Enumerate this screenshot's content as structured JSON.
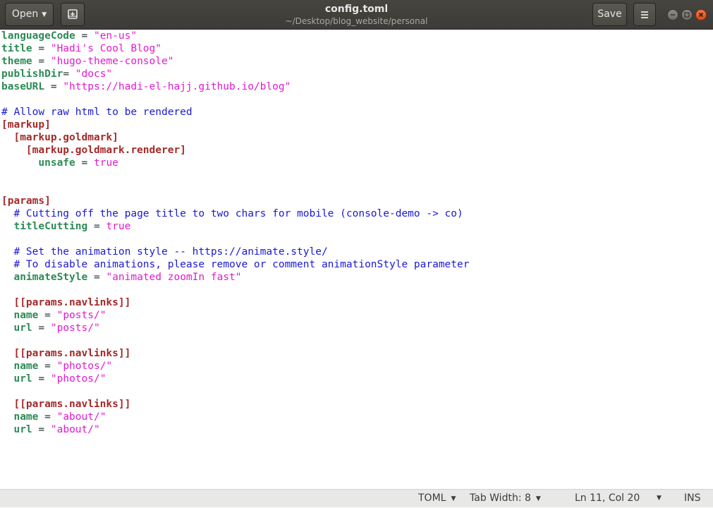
{
  "header": {
    "open_label": "Open",
    "title": "config.toml",
    "subtitle": "~/Desktop/blog_website/personal",
    "save_label": "Save"
  },
  "editor": {
    "lines": [
      [
        {
          "t": "key",
          "v": "languageCode"
        },
        {
          "t": "op",
          "v": " = "
        },
        {
          "t": "str",
          "v": "\"en-us\""
        }
      ],
      [
        {
          "t": "key",
          "v": "title"
        },
        {
          "t": "op",
          "v": " = "
        },
        {
          "t": "str",
          "v": "\"Hadi's Cool Blog\""
        }
      ],
      [
        {
          "t": "key",
          "v": "theme"
        },
        {
          "t": "op",
          "v": " = "
        },
        {
          "t": "str",
          "v": "\"hugo-theme-console\""
        }
      ],
      [
        {
          "t": "key",
          "v": "publishDir"
        },
        {
          "t": "op",
          "v": "= "
        },
        {
          "t": "str",
          "v": "\"docs\""
        }
      ],
      [
        {
          "t": "key",
          "v": "baseURL"
        },
        {
          "t": "op",
          "v": " = "
        },
        {
          "t": "str",
          "v": "\"https://hadi-el-hajj.github.io/blog\""
        }
      ],
      [],
      [
        {
          "t": "com",
          "v": "# Allow raw html to be rendered"
        }
      ],
      [
        {
          "t": "sec",
          "v": "[markup]"
        }
      ],
      [
        {
          "t": "op",
          "v": "  "
        },
        {
          "t": "sec",
          "v": "[markup.goldmark]"
        }
      ],
      [
        {
          "t": "op",
          "v": "    "
        },
        {
          "t": "sec",
          "v": "[markup.goldmark.renderer]"
        }
      ],
      [
        {
          "t": "op",
          "v": "      "
        },
        {
          "t": "key",
          "v": "unsafe"
        },
        {
          "t": "op",
          "v": " = "
        },
        {
          "t": "bool",
          "v": "true"
        }
      ],
      [],
      [],
      [
        {
          "t": "sec",
          "v": "[params]"
        }
      ],
      [
        {
          "t": "op",
          "v": "  "
        },
        {
          "t": "com",
          "v": "# Cutting off the page title to two chars for mobile (console-demo -> co)"
        }
      ],
      [
        {
          "t": "op",
          "v": "  "
        },
        {
          "t": "key",
          "v": "titleCutting"
        },
        {
          "t": "op",
          "v": " = "
        },
        {
          "t": "bool",
          "v": "true"
        }
      ],
      [],
      [
        {
          "t": "op",
          "v": "  "
        },
        {
          "t": "com",
          "v": "# Set the animation style -- https://animate.style/"
        }
      ],
      [
        {
          "t": "op",
          "v": "  "
        },
        {
          "t": "com",
          "v": "# To disable animations, please remove or comment animationStyle parameter"
        }
      ],
      [
        {
          "t": "op",
          "v": "  "
        },
        {
          "t": "key",
          "v": "animateStyle"
        },
        {
          "t": "op",
          "v": " = "
        },
        {
          "t": "str",
          "v": "\"animated zoomIn fast\""
        }
      ],
      [],
      [
        {
          "t": "op",
          "v": "  "
        },
        {
          "t": "sec",
          "v": "[[params.navlinks]]"
        }
      ],
      [
        {
          "t": "op",
          "v": "  "
        },
        {
          "t": "key",
          "v": "name"
        },
        {
          "t": "op",
          "v": " = "
        },
        {
          "t": "str",
          "v": "\"posts/\""
        }
      ],
      [
        {
          "t": "op",
          "v": "  "
        },
        {
          "t": "key",
          "v": "url"
        },
        {
          "t": "op",
          "v": " = "
        },
        {
          "t": "str",
          "v": "\"posts/\""
        }
      ],
      [],
      [
        {
          "t": "op",
          "v": "  "
        },
        {
          "t": "sec",
          "v": "[[params.navlinks]]"
        }
      ],
      [
        {
          "t": "op",
          "v": "  "
        },
        {
          "t": "key",
          "v": "name"
        },
        {
          "t": "op",
          "v": " = "
        },
        {
          "t": "str",
          "v": "\"photos/\""
        }
      ],
      [
        {
          "t": "op",
          "v": "  "
        },
        {
          "t": "key",
          "v": "url"
        },
        {
          "t": "op",
          "v": " = "
        },
        {
          "t": "str",
          "v": "\"photos/\""
        }
      ],
      [],
      [
        {
          "t": "op",
          "v": "  "
        },
        {
          "t": "sec",
          "v": "[[params.navlinks]]"
        }
      ],
      [
        {
          "t": "op",
          "v": "  "
        },
        {
          "t": "key",
          "v": "name"
        },
        {
          "t": "op",
          "v": " = "
        },
        {
          "t": "str",
          "v": "\"about/\""
        }
      ],
      [
        {
          "t": "op",
          "v": "  "
        },
        {
          "t": "key",
          "v": "url"
        },
        {
          "t": "op",
          "v": " = "
        },
        {
          "t": "str",
          "v": "\"about/\""
        }
      ]
    ]
  },
  "statusbar": {
    "language": "TOML",
    "tab_width": "Tab Width: 8",
    "cursor_position": "Ln 11, Col 20",
    "insert_mode": "INS"
  },
  "colors": {
    "headerbar": "#3c3b37",
    "key": "#2d8b57",
    "string": "#e11bd0",
    "comment": "#1a1ad4",
    "section": "#a42a2a",
    "close_button": "#df4b16"
  },
  "icons": [
    "new-tab-icon",
    "hamburger-menu-icon",
    "minimize-icon",
    "maximize-icon",
    "close-icon"
  ]
}
